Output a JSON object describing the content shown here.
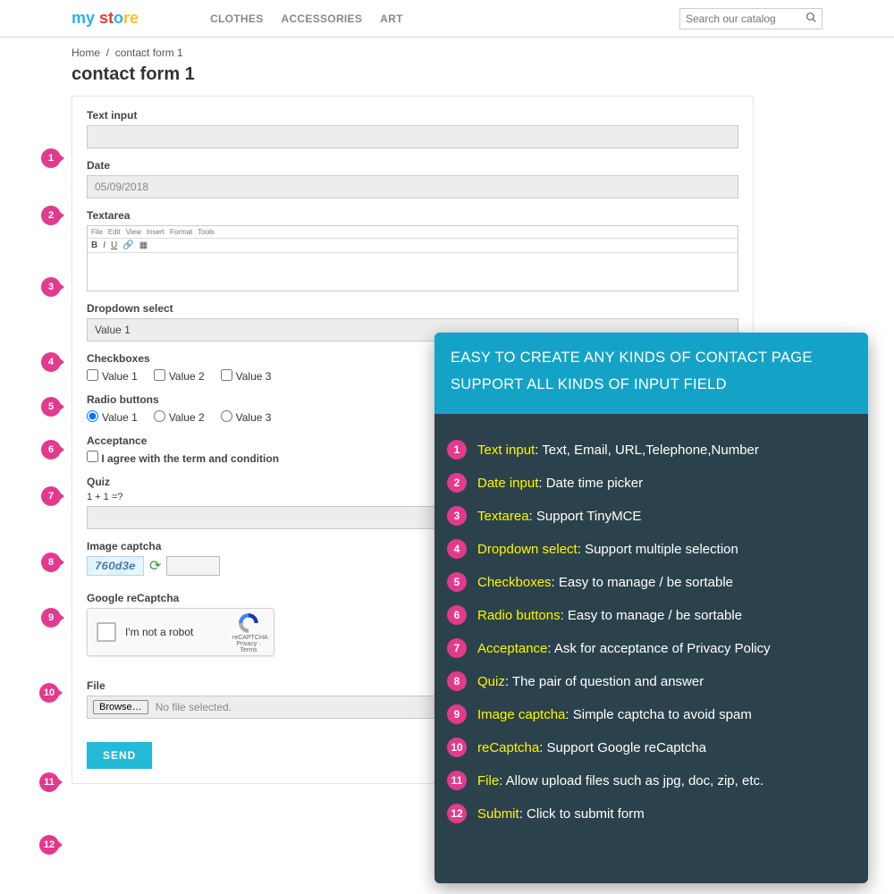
{
  "header": {
    "logo": {
      "my": "my",
      "space": " ",
      "st": "st",
      "o": "o",
      "re": "re"
    },
    "nav": [
      "CLOTHES",
      "ACCESSORIES",
      "ART"
    ],
    "search_placeholder": "Search our catalog"
  },
  "breadcrumb": {
    "home": "Home",
    "sep": "/",
    "page": "contact form 1"
  },
  "page_title": "contact form 1",
  "form": {
    "text_label": "Text input",
    "date_label": "Date",
    "date_value": "05/09/2018",
    "textarea_label": "Textarea",
    "mce_menu": [
      "File",
      "Edit",
      "View",
      "Insert",
      "Format",
      "Tools"
    ],
    "dropdown_label": "Dropdown select",
    "dropdown_value": "Value 1",
    "checkboxes_label": "Checkboxes",
    "checkbox_values": [
      "Value 1",
      "Value 2",
      "Value 3"
    ],
    "radios_label": "Radio buttons",
    "radio_values": [
      "Value 1",
      "Value 2",
      "Value 3"
    ],
    "acceptance_label": "Acceptance",
    "acceptance_text": "I agree with the term and condition",
    "quiz_label": "Quiz",
    "quiz_question": "1 + 1 =?",
    "captcha_label": "Image captcha",
    "captcha_text": "760d3e",
    "recaptcha_label": "Google reCaptcha",
    "recaptcha_text": "I'm not a robot",
    "recaptcha_brand": "reCAPTCHA",
    "recaptcha_sub": "Privacy · Terms",
    "file_label": "File",
    "browse": "Browse…",
    "no_file": "No file selected.",
    "send": "SEND"
  },
  "badges": [
    1,
    2,
    3,
    4,
    5,
    6,
    7,
    8,
    9,
    10,
    11,
    12
  ],
  "overlay": {
    "head1": "EASY TO CREATE ANY KINDS OF CONTACT PAGE",
    "head2": "SUPPORT ALL KINDS OF INPUT FIELD",
    "rows": [
      {
        "n": "1",
        "k": "Text input",
        "v": ": Text, Email, URL,Telephone,Number"
      },
      {
        "n": "2",
        "k": "Date input",
        "v": ": Date time picker"
      },
      {
        "n": "3",
        "k": "Textarea",
        "v": ": Support TinyMCE"
      },
      {
        "n": "4",
        "k": "Dropdown select",
        "v": ": Support multiple selection"
      },
      {
        "n": "5",
        "k": "Checkboxes",
        "v": ": Easy to manage / be sortable"
      },
      {
        "n": "6",
        "k": "Radio buttons",
        "v": ": Easy to manage / be sortable"
      },
      {
        "n": "7",
        "k": "Acceptance",
        "v": ": Ask for acceptance of Privacy Policy"
      },
      {
        "n": "8",
        "k": "Quiz",
        "v": ": The pair of question and answer"
      },
      {
        "n": "9",
        "k": "Image captcha",
        "v": ": Simple captcha to avoid spam"
      },
      {
        "n": "10",
        "k": "reCaptcha",
        "v": ": Support Google reCaptcha"
      },
      {
        "n": "11",
        "k": "File",
        "v": ": Allow upload files such as jpg, doc, zip, etc."
      },
      {
        "n": "12",
        "k": "Submit",
        "v": ": Click to submit form"
      }
    ]
  }
}
